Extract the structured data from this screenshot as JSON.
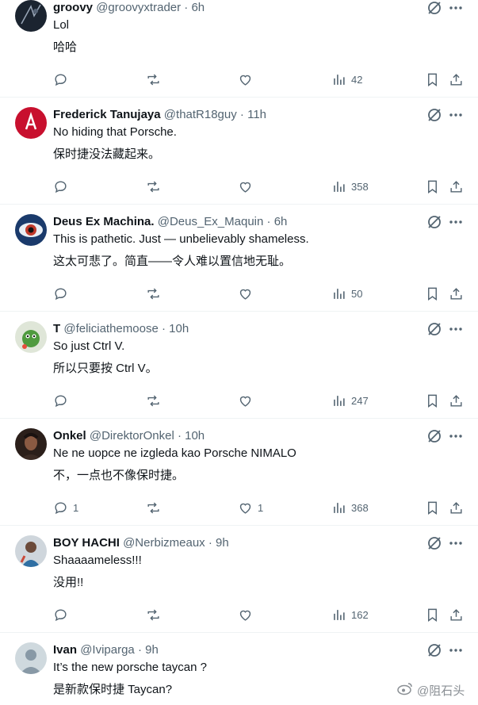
{
  "tweets": [
    {
      "name": "groovy",
      "handle": "@groovyxtrader",
      "time": "6h",
      "text": "Lol",
      "translation": "哈哈",
      "replies": "",
      "likes": "",
      "views": "42",
      "avatar_icon": "dark-abstract-avatar"
    },
    {
      "name": "Frederick Tanujaya",
      "handle": "@thatR18guy",
      "time": "11h",
      "text": "No hiding that Porsche.",
      "translation": "保时捷没法藏起来。",
      "replies": "",
      "likes": "",
      "views": "358",
      "avatar_icon": "red-logo-avatar"
    },
    {
      "name": "Deus Ex Machina.",
      "handle": "@Deus_Ex_Maquin",
      "time": "6h",
      "text": "This is pathetic. Just — unbelievably shameless.",
      "translation": "这太可悲了。简直——令人难以置信地无耻。",
      "replies": "",
      "likes": "",
      "views": "50",
      "avatar_icon": "eye-avatar"
    },
    {
      "name": "T",
      "handle": "@feliciathemoose",
      "time": "10h",
      "text": "So just Ctrl V.",
      "translation": "所以只要按 Ctrl V。",
      "replies": "",
      "likes": "",
      "views": "247",
      "avatar_icon": "green-creature-avatar"
    },
    {
      "name": "Onkel",
      "handle": "@DirektorOnkel",
      "time": "10h",
      "text": "Ne ne uopce ne izgleda kao Porsche NIMALO",
      "translation": "不，一点也不像保时捷。",
      "replies": "1",
      "likes": "1",
      "views": "368",
      "avatar_icon": "portrait-avatar"
    },
    {
      "name": "BOY HACHI",
      "handle": "@Nerbizmeaux",
      "time": "9h",
      "text": "Shaaaameless!!!",
      "translation": "没用!!",
      "replies": "",
      "likes": "",
      "views": "162",
      "avatar_icon": "person-photo-avatar"
    },
    {
      "name": "Ivan",
      "handle": "@Iviparga",
      "time": "9h",
      "text": "It’s the new porsche taycan ?",
      "translation": "是新款保时捷 Taycan?",
      "replies": "",
      "likes": "",
      "views": "",
      "avatar_icon": "default-avatar"
    }
  ],
  "separator": "·",
  "watermark": {
    "icon": "weibo-icon",
    "text": "@阻石头"
  },
  "colors": {
    "text": "#0f1419",
    "secondary": "#536471",
    "border": "#eff3f4"
  }
}
